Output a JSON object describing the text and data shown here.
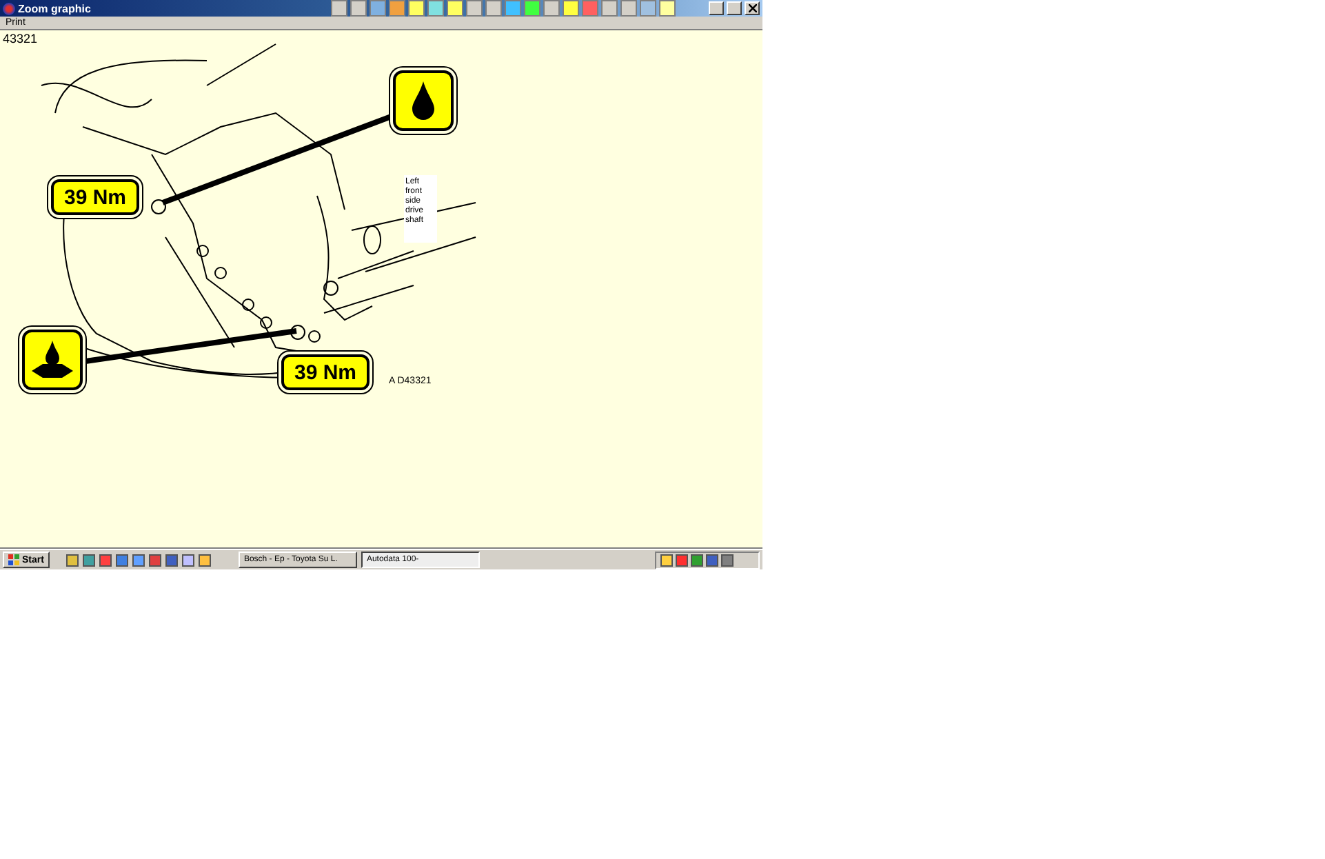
{
  "window": {
    "title": "Zoom graphic"
  },
  "menu": [
    "Print"
  ],
  "figure": {
    "number": "43321",
    "callouts": [
      {
        "kind": "torque",
        "text": "39 Nm"
      },
      {
        "kind": "torque",
        "text": "39 Nm"
      }
    ],
    "part_label": [
      "Left",
      "front",
      "side",
      "drive",
      "shaft"
    ],
    "reference": "A D43321"
  },
  "taskbar": {
    "start": "Start",
    "tasks": [
      {
        "label": "Bosch - Ep - Toyota Su L.",
        "selected": false
      },
      {
        "label": "Autodata 100-",
        "selected": true
      }
    ]
  }
}
